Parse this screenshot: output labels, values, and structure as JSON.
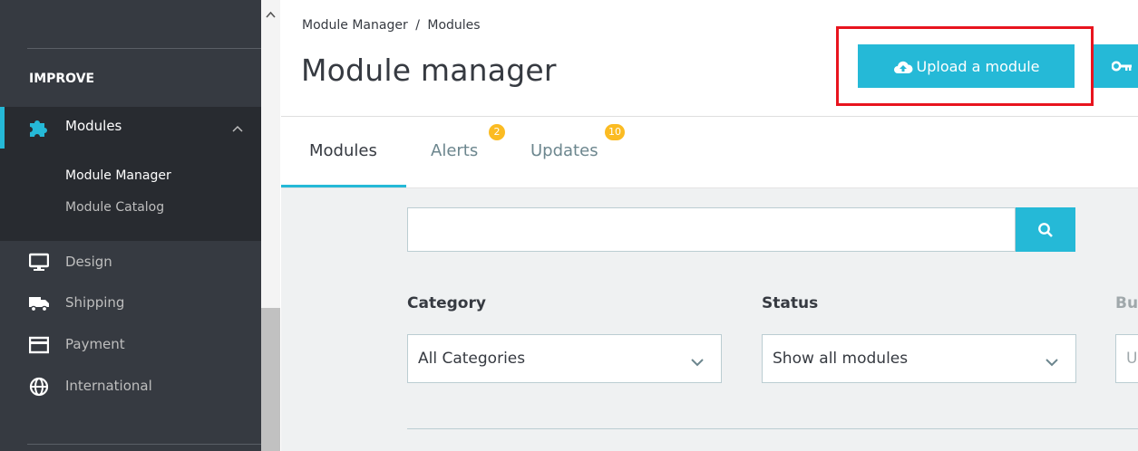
{
  "sidebar": {
    "section_title": "IMPROVE",
    "modules": {
      "label": "Modules",
      "submenu": [
        "Module Manager",
        "Module Catalog"
      ]
    },
    "items": [
      {
        "label": "Design",
        "icon": "monitor-icon"
      },
      {
        "label": "Shipping",
        "icon": "truck-icon"
      },
      {
        "label": "Payment",
        "icon": "credit-card-icon"
      },
      {
        "label": "International",
        "icon": "globe-icon"
      }
    ]
  },
  "header": {
    "breadcrumb": [
      "Module Manager",
      "/",
      "Modules"
    ],
    "title": "Module manager",
    "upload_label": "Upload a module",
    "connect_icon": "key-icon"
  },
  "tabs": [
    {
      "label": "Modules",
      "active": true,
      "badge": ""
    },
    {
      "label": "Alerts",
      "active": false,
      "badge": "2"
    },
    {
      "label": "Updates",
      "active": false,
      "badge": "10"
    }
  ],
  "filters": {
    "search_value": "",
    "category_label": "Category",
    "category_value": "All Categories",
    "status_label": "Status",
    "status_value": "Show all modules",
    "bulk_label": "Bu",
    "bulk_value": "U"
  },
  "colors": {
    "accent": "#25b9d7",
    "sidebar_bg": "#363a41",
    "highlight": "#e8141e",
    "badge": "#fbbb22"
  }
}
